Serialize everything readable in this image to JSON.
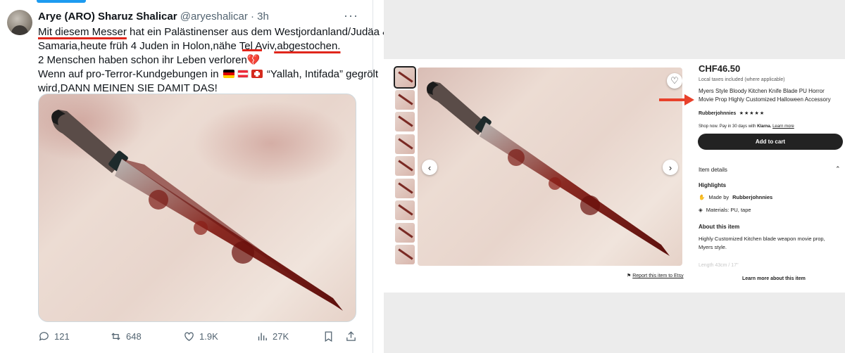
{
  "tweet": {
    "name": "Arye (ARO) Sharuz Shalicar",
    "handle": "@aryeshalicar",
    "time": "3h",
    "more": "···",
    "lines": [
      [
        "Mit diesem Messer",
        " hat ein Palästinenser aus dem Westjordanland/Judäa &"
      ],
      [
        "Samaria,heute früh 4 Juden in Holon,nähe Tel Aviv",
        ",abgestochen."
      ],
      [
        "2 Menschen haben schon ihr Leben verloren",
        "💔"
      ],
      [
        "Wenn auf pro-Terror-Kundgebungen in ",
        " “Yallah, Intifada” gegrölt"
      ],
      [
        "wird,DANN MEINEN SIE DAMIT DAS!"
      ]
    ],
    "actions": {
      "replies": "121",
      "reposts": "648",
      "likes": "1.9K",
      "views": "27K"
    }
  },
  "etsy": {
    "price": "CHF46.50",
    "tax_note": "Local taxes included (where applicable)",
    "title": "Myers Style Bloody Kitchen Knife Blade PU Horror Movie Prop Highly Customized Halloween Accessory",
    "seller": "Rubberjohnnies",
    "stars": "★★★★★",
    "klarna": {
      "prefix": "Shop now. Pay in 30 days with",
      "brand": "Klarna.",
      "link": "Learn more"
    },
    "add_to_cart": "Add to cart",
    "item_details": "Item details",
    "highlights": "Highlights",
    "made_by_prefix": "Made by",
    "made_by": "Rubberjohnnies",
    "materials": "Materials: PU, tape",
    "about_heading": "About this item",
    "about_text_1": "Highly Customized Kitchen blade weapon movie prop,",
    "about_text_2": "Myers style.",
    "length": "Length 43cm / 17\"",
    "report": "Report this item to Etsy",
    "learn_more": "Learn more about this item",
    "thumb_count": 9
  },
  "colors": {
    "underline": "#e0261b",
    "twitter_blue": "#1d9bf0",
    "arrow": "#e8412b",
    "cart_bg": "#222222"
  }
}
